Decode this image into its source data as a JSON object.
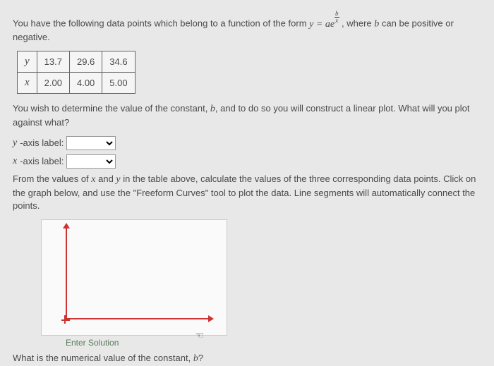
{
  "intro": {
    "p1a": "You have the following data points which belong to a function of the form ",
    "p1_formula_lhs": "y",
    "p1_formula_eq": " = ",
    "p1_formula_a": "a",
    "p1_formula_e": "e",
    "p1_formula_num": "b",
    "p1_formula_den": "x",
    "p1b": ", where ",
    "p1_bvar": "b",
    "p1c": " can be positive or negative."
  },
  "table": {
    "row1_hdr": "y",
    "row1": [
      "13.7",
      "29.6",
      "34.6"
    ],
    "row2_hdr": "x",
    "row2": [
      "2.00",
      "4.00",
      "5.00"
    ]
  },
  "p2a": "You wish to determine the value of the constant, ",
  "p2_bvar": "b",
  "p2b": ", and to do so you will construct a linear plot. What will you plot against what?",
  "y_label": "y",
  "y_axis_label_suffix": "-axis label:",
  "x_label": "x",
  "x_axis_label_suffix": "-axis label:",
  "p3a": "From the values of ",
  "p3_xvar": "x",
  "p3b": " and ",
  "p3_yvar": "y",
  "p3c": " in the table above, calculate the values of the three corresponding data points. Click on the graph below, and use the \"Freeform Curves\" tool to plot the data. Line segments will automatically connect the points.",
  "enter_solution": "Enter Solution",
  "p4a": "What is the numerical value of the constant, ",
  "p4_bvar": "b",
  "p4b": "?",
  "chart_data": {
    "type": "line",
    "title": "",
    "xlabel": "",
    "ylabel": "",
    "series": [],
    "note": "empty plot area awaiting user-drawn points"
  }
}
